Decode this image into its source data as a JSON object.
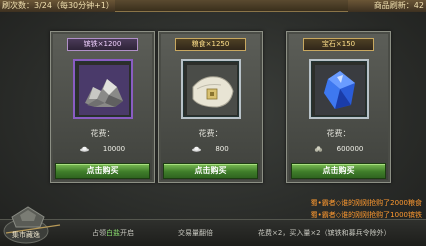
{
  "header": {
    "refresh_count": "刷次数：3/24（每30分钟+1）",
    "refresh_timer": "商品刷新：42"
  },
  "cards": [
    {
      "name": "镔铁×1200",
      "cost_label": "花费：",
      "price": "10000",
      "currency_icon": "silver-ingot-icon",
      "item_icon": "iron-ore-icon",
      "buy_label": "点击购买"
    },
    {
      "name": "粮食×1250",
      "cost_label": "花费：",
      "price": "800",
      "currency_icon": "silver-ingot-icon",
      "item_icon": "grain-sack-icon",
      "buy_label": "点击购买"
    },
    {
      "name": "宝石×150",
      "cost_label": "花费：",
      "price": "600000",
      "currency_icon": "coin-pile-icon",
      "item_icon": "blue-gem-icon",
      "buy_label": "点击购买"
    }
  ],
  "log": [
    {
      "text": "蜀•霸者◇谁的刚刚抢购了2000粮食"
    },
    {
      "text": "蜀•霸者◇谁的刚刚抢购了1000镔铁"
    }
  ],
  "footer": {
    "back_label": "集市藏逸",
    "hint1_a": "占领",
    "hint1_b": "白盐",
    "hint1_c": "开启",
    "hint2": "交易量翻倍",
    "hint3": "花费×2，买入量×2（镔铁和募兵令除外）"
  },
  "colors": {
    "buy_button": "#3f7d2a",
    "log_text": "#ff9a30",
    "highlight": "#8be070"
  }
}
